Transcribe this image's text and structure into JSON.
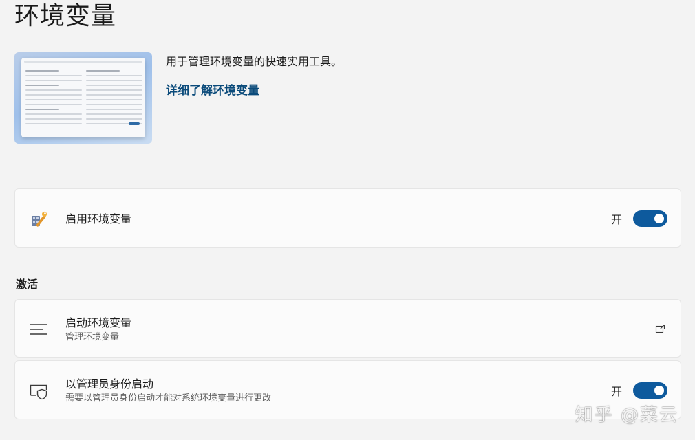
{
  "page": {
    "title": "环境变量"
  },
  "hero": {
    "description": "用于管理环境变量的快速实用工具。",
    "learn_more_link": "详细了解环境变量"
  },
  "enable_card": {
    "label": "启用环境变量",
    "toggle_state": "开",
    "toggle_on": true,
    "icon": "wrench-tool-icon"
  },
  "activation": {
    "section_title": "激活",
    "launch_card": {
      "label": "启动环境变量",
      "description": "管理环境变量",
      "icon": "list-lines-icon",
      "action_icon": "open-external-icon"
    },
    "admin_card": {
      "label": "以管理员身份启动",
      "description": "需要以管理员身份启动才能对系统环境变量进行更改",
      "toggle_state": "开",
      "toggle_on": true,
      "icon": "shield-window-icon"
    }
  },
  "watermark": {
    "text": "知乎 @菜云"
  },
  "colors": {
    "accent": "#0e5a9d",
    "link": "#0a4a7a",
    "background": "#f3f3f3",
    "card": "#fbfbfb"
  }
}
